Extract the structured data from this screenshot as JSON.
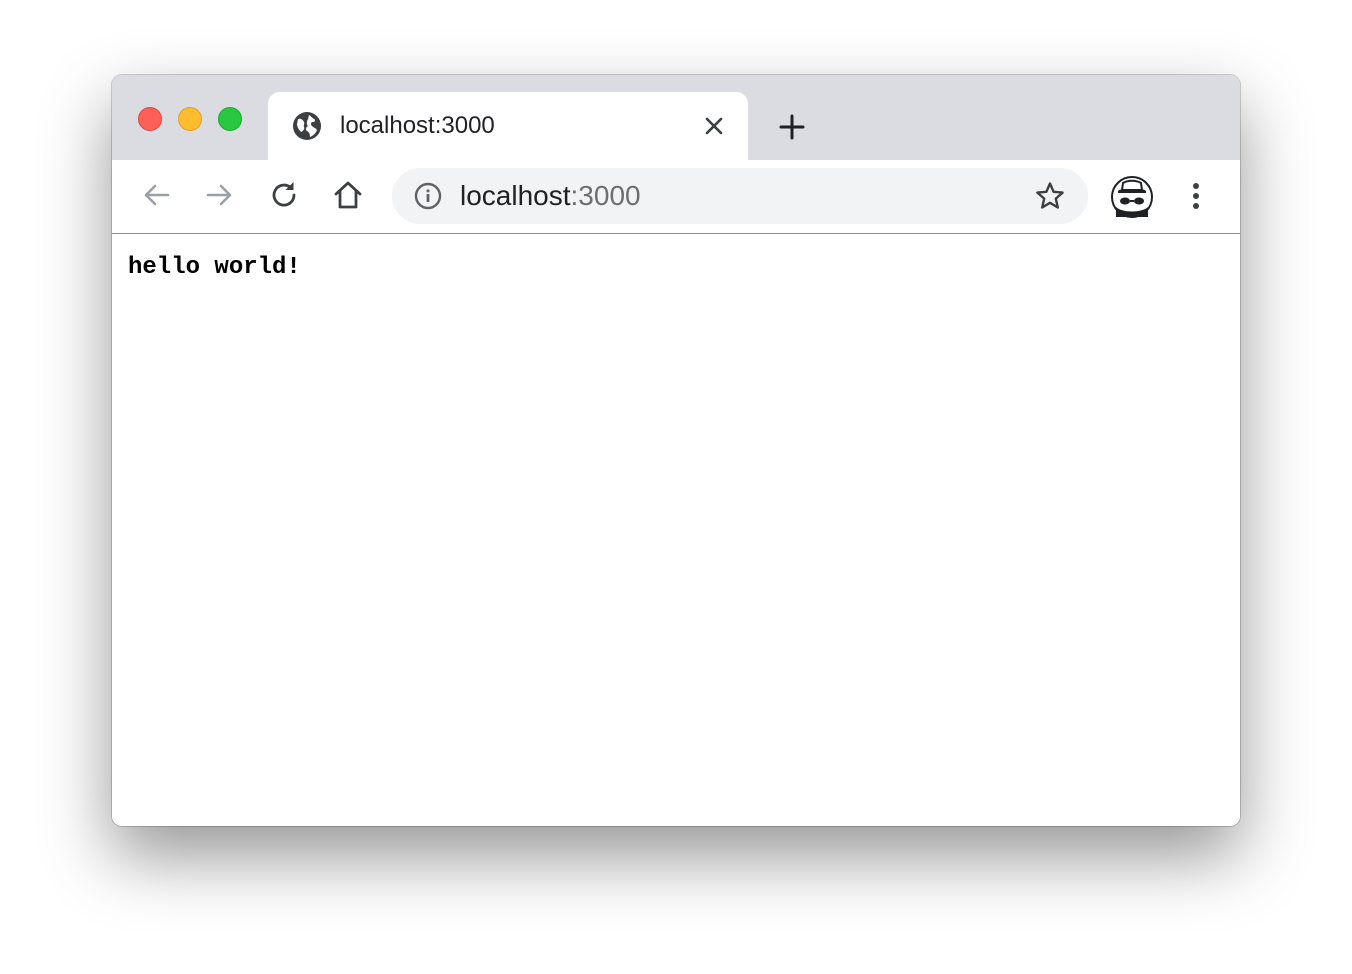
{
  "tab": {
    "title": "localhost:3000",
    "favicon_icon": "globe-icon"
  },
  "omnibox": {
    "host": "localhost",
    "port": ":3000"
  },
  "page": {
    "body_text": "hello world!"
  },
  "colors": {
    "titlebar": "#dadce2",
    "omnibox_bg": "#f1f3f4",
    "close": "#fe5f57",
    "minimize": "#febc2e",
    "maximize": "#29c840"
  }
}
